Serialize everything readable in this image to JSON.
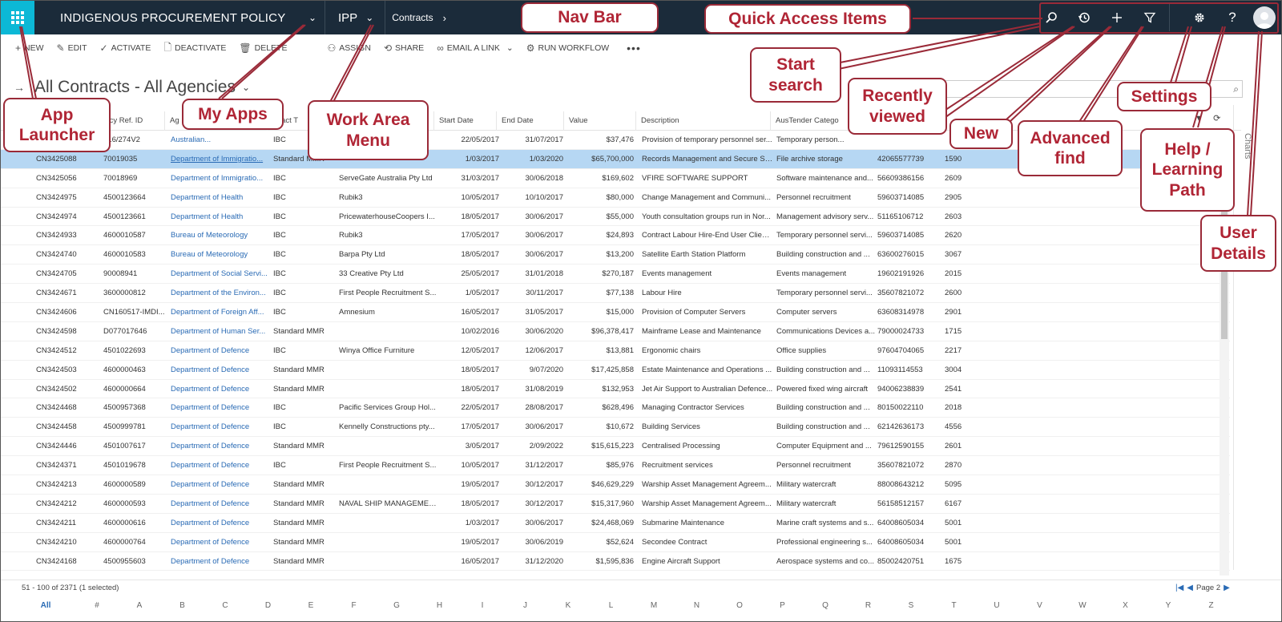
{
  "navbar": {
    "app_title": "INDIGENOUS PROCUREMENT POLICY",
    "area": "IPP",
    "breadcrumb": "Contracts",
    "colors": {
      "bar": "#1b2b3a",
      "launcher": "#0cb8d6"
    },
    "icons": [
      "search-icon",
      "recently-viewed-icon",
      "new-icon",
      "advanced-find-icon",
      "settings-icon",
      "help-icon",
      "user-avatar-icon"
    ]
  },
  "commands": [
    {
      "icon": "+",
      "label": "NEW"
    },
    {
      "icon": "✎",
      "label": "EDIT"
    },
    {
      "icon": "✓",
      "label": "ACTIVATE"
    },
    {
      "icon": "🗋",
      "label": "DEACTIVATE"
    },
    {
      "icon": "🗑",
      "label": "DELETE"
    },
    {
      "icon": "⚇",
      "label": "ASSIGN"
    },
    {
      "icon": "⟲",
      "label": "SHARE"
    },
    {
      "icon": "∞",
      "label": "EMAIL A LINK"
    },
    {
      "icon": "⚙",
      "label": "RUN WORKFLOW"
    }
  ],
  "view": {
    "title": "All Contracts - All Agencies"
  },
  "grid": {
    "columns": [
      "ency Ref. ID",
      "Ag",
      "ntract T",
      "",
      "Start Date",
      "End Date",
      "Value",
      "Description",
      "AusTender Catego",
      "",
      ""
    ],
    "rows": [
      [
        "",
        "016/274V2",
        "Australian...",
        "IBC",
        "",
        "22/05/2017",
        "31/07/2017",
        "$37,476",
        "Provision of temporary personnel ser...",
        "Temporary person...",
        "",
        ""
      ],
      [
        "CN3425088",
        "70019035",
        "Department of Immigratio...",
        "Standard MMR",
        "",
        "1/03/2017",
        "1/03/2020",
        "$65,700,000",
        "Records Management and Secure St...",
        "File archive storage",
        "42065577739",
        "1590"
      ],
      [
        "CN3425056",
        "70018969",
        "Department of Immigratio...",
        "IBC",
        "ServeGate Australia Pty Ltd",
        "31/03/2017",
        "30/06/2018",
        "$169,602",
        "VFIRE SOFTWARE SUPPORT",
        "Software maintenance and...",
        "56609386156",
        "2609"
      ],
      [
        "CN3424975",
        "4500123664",
        "Department of Health",
        "IBC",
        "Rubik3",
        "10/05/2017",
        "10/10/2017",
        "$80,000",
        "Change Management and Communi...",
        "Personnel recruitment",
        "59603714085",
        "2905"
      ],
      [
        "CN3424974",
        "4500123661",
        "Department of Health",
        "IBC",
        "PricewaterhouseCoopers I...",
        "18/05/2017",
        "30/06/2017",
        "$55,000",
        "Youth consultation groups run in Nor...",
        "Management advisory serv...",
        "51165106712",
        "2603"
      ],
      [
        "CN3424933",
        "4600010587",
        "Bureau of Meteorology",
        "IBC",
        "Rubik3",
        "17/05/2017",
        "30/06/2017",
        "$24,893",
        "Contract Labour Hire-End User Client...",
        "Temporary personnel servi...",
        "59603714085",
        "2620"
      ],
      [
        "CN3424740",
        "4600010583",
        "Bureau of Meteorology",
        "IBC",
        "Barpa Pty Ltd",
        "18/05/2017",
        "30/06/2017",
        "$13,200",
        "Satellite Earth Station Platform",
        "Building construction and ...",
        "63600276015",
        "3067"
      ],
      [
        "CN3424705",
        "90008941",
        "Department of Social Servi...",
        "IBC",
        "33 Creative Pty Ltd",
        "25/05/2017",
        "31/01/2018",
        "$270,187",
        "Events management",
        "Events management",
        "19602191926",
        "2015"
      ],
      [
        "CN3424671",
        "3600000812",
        "Department of the Environ...",
        "IBC",
        "First People Recruitment S...",
        "1/05/2017",
        "30/11/2017",
        "$77,138",
        "Labour Hire",
        "Temporary personnel servi...",
        "35607821072",
        "2600"
      ],
      [
        "CN3424606",
        "CN160517-IMDI...",
        "Department of Foreign Aff...",
        "IBC",
        "Amnesium",
        "16/05/2017",
        "31/05/2017",
        "$15,000",
        "Provision of Computer Servers",
        "Computer servers",
        "63608314978",
        "2901"
      ],
      [
        "CN3424598",
        "D077017646",
        "Department of Human Ser...",
        "Standard MMR",
        "",
        "10/02/2016",
        "30/06/2020",
        "$96,378,417",
        "Mainframe Lease and Maintenance",
        "Communications Devices a...",
        "79000024733",
        "1715"
      ],
      [
        "CN3424512",
        "4501022693",
        "Department of Defence",
        "IBC",
        "Winya Office Furniture",
        "12/05/2017",
        "12/06/2017",
        "$13,881",
        "Ergonomic chairs",
        "Office supplies",
        "97604704065",
        "2217"
      ],
      [
        "CN3424503",
        "4600000463",
        "Department of Defence",
        "Standard MMR",
        "",
        "18/05/2017",
        "9/07/2020",
        "$17,425,858",
        "Estate Maintenance and Operations ...",
        "Building construction and ...",
        "11093114553",
        "3004"
      ],
      [
        "CN3424502",
        "4600000664",
        "Department of Defence",
        "Standard MMR",
        "",
        "18/05/2017",
        "31/08/2019",
        "$132,953",
        "Jet Air Support to Australian Defence...",
        "Powered fixed wing aircraft",
        "94006238839",
        "2541"
      ],
      [
        "CN3424468",
        "4500957368",
        "Department of Defence",
        "IBC",
        "Pacific Services Group Hol...",
        "22/05/2017",
        "28/08/2017",
        "$628,496",
        "Managing Contractor Services",
        "Building construction and ...",
        "80150022110",
        "2018"
      ],
      [
        "CN3424458",
        "4500999781",
        "Department of Defence",
        "IBC",
        "Kennelly Constructions pty...",
        "17/05/2017",
        "30/06/2017",
        "$10,672",
        "Building Services",
        "Building construction and ...",
        "62142636173",
        "4556"
      ],
      [
        "CN3424446",
        "4501007617",
        "Department of Defence",
        "Standard MMR",
        "",
        "3/05/2017",
        "2/09/2022",
        "$15,615,223",
        "Centralised Processing",
        "Computer Equipment and ...",
        "79612590155",
        "2601"
      ],
      [
        "CN3424371",
        "4501019678",
        "Department of Defence",
        "IBC",
        "First People Recruitment S...",
        "10/05/2017",
        "31/12/2017",
        "$85,976",
        "Recruitment services",
        "Personnel recruitment",
        "35607821072",
        "2870"
      ],
      [
        "CN3424213",
        "4600000589",
        "Department of Defence",
        "Standard MMR",
        "",
        "19/05/2017",
        "30/12/2017",
        "$46,629,229",
        "Warship Asset Management Agreem...",
        "Military watercraft",
        "88008643212",
        "5095"
      ],
      [
        "CN3424212",
        "4600000593",
        "Department of Defence",
        "Standard MMR",
        "NAVAL SHIP MANAGEMENT",
        "18/05/2017",
        "30/12/2017",
        "$15,317,960",
        "Warship Asset Management Agreem...",
        "Military watercraft",
        "56158512157",
        "6167"
      ],
      [
        "CN3424211",
        "4600000616",
        "Department of Defence",
        "Standard MMR",
        "",
        "1/03/2017",
        "30/06/2017",
        "$24,468,069",
        "Submarine Maintenance",
        "Marine craft systems and s...",
        "64008605034",
        "5001"
      ],
      [
        "CN3424210",
        "4600000764",
        "Department of Defence",
        "Standard MMR",
        "",
        "19/05/2017",
        "30/06/2019",
        "$52,624",
        "Secondee Contract",
        "Professional engineering s...",
        "64008605034",
        "5001"
      ],
      [
        "CN3424168",
        "4500955603",
        "Department of Defence",
        "Standard MMR",
        "",
        "16/05/2017",
        "31/12/2020",
        "$1,595,836",
        "Engine Aircraft Support",
        "Aerospace systems and co...",
        "85002420751",
        "1675"
      ]
    ],
    "selected_row": 1
  },
  "footer": {
    "count": "51 - 100 of 2371 (1 selected)",
    "page": "Page 2",
    "letters": [
      "All",
      "#",
      "A",
      "B",
      "C",
      "D",
      "E",
      "F",
      "G",
      "H",
      "I",
      "J",
      "K",
      "L",
      "M",
      "N",
      "O",
      "P",
      "Q",
      "R",
      "S",
      "T",
      "U",
      "V",
      "W",
      "X",
      "Y",
      "Z"
    ]
  },
  "side_panel": {
    "label": "Charts"
  },
  "callouts": {
    "nav_bar": "Nav Bar",
    "quick_access": "Quick Access Items",
    "start_search": "Start search",
    "recently_viewed": "Recently viewed",
    "new": "New",
    "advanced_find": "Advanced find",
    "settings": "Settings",
    "help": "Help / Learning Path",
    "user_details": "User Details",
    "app_launcher": "App Launcher",
    "my_apps": "My Apps",
    "work_area": "Work Area Menu",
    "color": "#b02535"
  }
}
